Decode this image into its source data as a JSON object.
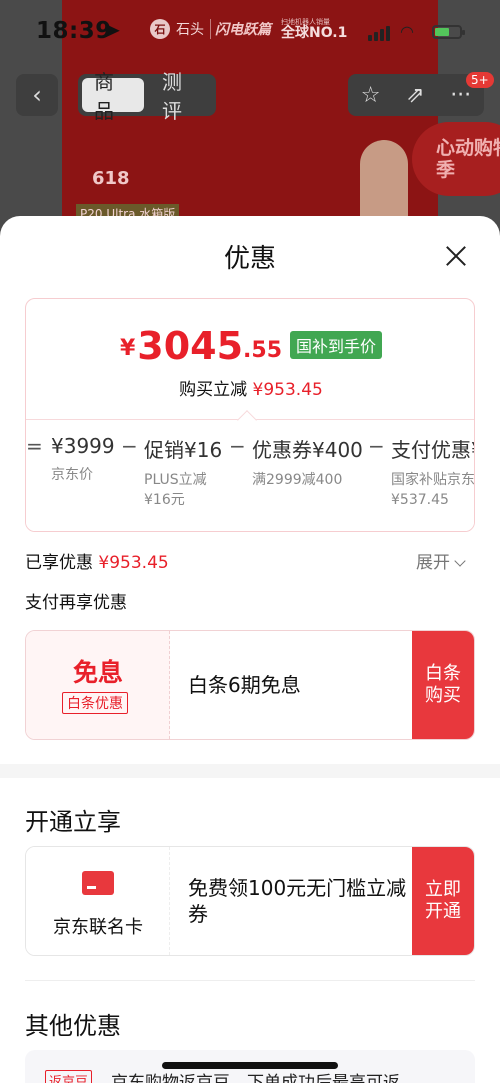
{
  "status_bar": {
    "time": "18:39",
    "brand_icon_text": "石",
    "brand_name": "石头",
    "brand_slogan": "闪电跃篇",
    "brand_small": "扫地机器人销量",
    "brand_big": "全球NO.1"
  },
  "nav": {
    "back_glyph": "‹",
    "tabs": [
      {
        "label": "商品"
      },
      {
        "label": "测评"
      }
    ],
    "badge": "5+",
    "action_glyphs": [
      "☆",
      "⇗",
      "···"
    ]
  },
  "background": {
    "promo_text": "心动购物季",
    "anniv": "618",
    "model": "P20 Ultra 水箱版"
  },
  "sheet": {
    "title": "优惠"
  },
  "price": {
    "currency": "¥",
    "integer": "3045",
    "decimal": ".55",
    "tag": "国补到手价",
    "sub_label": "购买立减",
    "sub_amount": "¥953.45"
  },
  "breakdown": {
    "ops": [
      "=",
      "−",
      "−",
      "−"
    ],
    "items": [
      {
        "value": "¥3999",
        "label": "京东价",
        "label2": ""
      },
      {
        "value": "促销¥16",
        "label": "PLUS立减",
        "label2": "¥16元"
      },
      {
        "value": "优惠券¥400",
        "label": "满2999减400",
        "label2": ""
      },
      {
        "value": "支付优惠¥",
        "label": "国家补贴京东",
        "label2": "¥537.45"
      }
    ]
  },
  "enjoyed": {
    "label": "已享优惠",
    "amount": "¥953.45",
    "expand_label": "展开"
  },
  "pay_section": {
    "title": "支付再享优惠",
    "card": {
      "big": "免息",
      "tag": "白条优惠",
      "text": "白条6期免息",
      "action": "白条购买"
    }
  },
  "open_section": {
    "title": "开通立享",
    "card": {
      "icon": "card-icon",
      "label": "京东联名卡",
      "text": "免费领100元无门槛立减券",
      "action": "立即开通"
    }
  },
  "other_section": {
    "title": "其他优惠",
    "item": {
      "tag": "返京豆",
      "text": "京东购物返京豆，下单成功后最高可返"
    }
  },
  "colors": {
    "accent_red": "#e8202a",
    "button_red": "#e8383d",
    "tag_green": "#41a752"
  }
}
